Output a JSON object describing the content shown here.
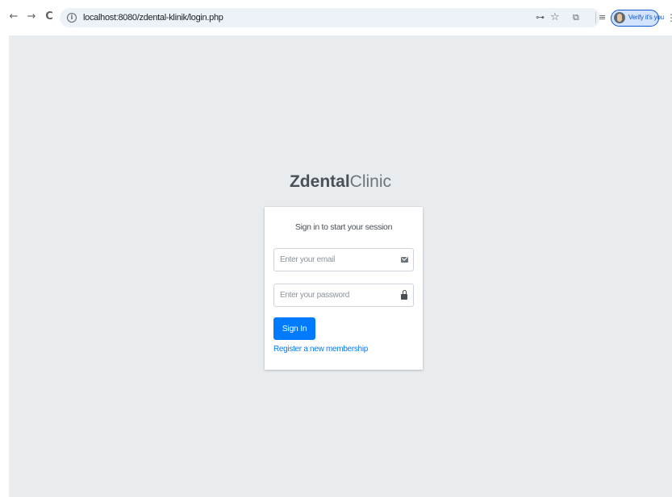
{
  "browser": {
    "back_icon": "←",
    "forward_icon": "→",
    "reload_icon": "C",
    "info_icon": "i",
    "url": "localhost:8080/zdental-klinik/login.php",
    "key_icon": "⊶",
    "star_icon": "☆",
    "extensions_icon": "⧉",
    "reading_list_icon": "≡",
    "verify_label": "Verify it's you",
    "menu_icon": "⋮",
    "accent_color": "#0b57d0"
  },
  "login": {
    "logo_bold": "Zdental",
    "logo_light": "Clinic",
    "message": "Sign in to start your session",
    "email_placeholder": "Enter your email",
    "password_placeholder": "Enter your password",
    "signin_label": "Sign In",
    "register_label": "Register a new membership",
    "button_color": "#007bff",
    "page_background": "#e9ecef"
  }
}
